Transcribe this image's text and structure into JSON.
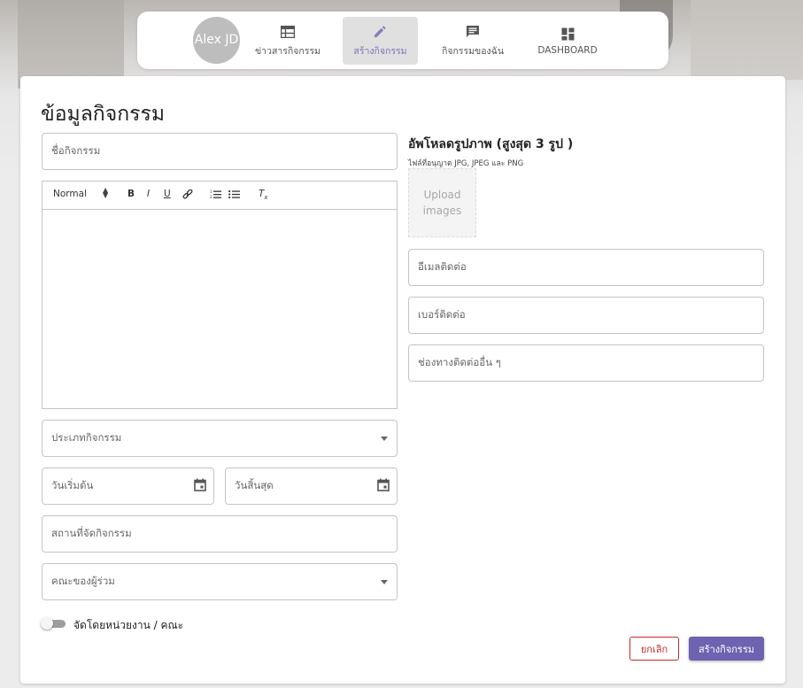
{
  "nav": {
    "avatar_text": "Alex JD",
    "items": [
      {
        "label": "ข่าวสารกิจกรรม",
        "icon": "table-icon",
        "active": false
      },
      {
        "label": "สร้างกิจกรรม",
        "icon": "pencil-icon",
        "active": true
      },
      {
        "label": "กิจกรรมของฉัน",
        "icon": "chat-icon",
        "active": false
      },
      {
        "label": "DASHBOARD",
        "icon": "dashboard-icon",
        "active": false
      }
    ]
  },
  "form": {
    "title": "ข้อมูลกิจกรรม",
    "activity_name_placeholder": "ชื่อกิจกรรม",
    "editor": {
      "format_select": "Normal",
      "tools": [
        "bold-icon",
        "italic-icon",
        "underline-icon",
        "link-icon",
        "ordered-list-icon",
        "bullet-list-icon",
        "clear-format-icon"
      ]
    },
    "activity_type_placeholder": "ประเภทกิจกรรม",
    "start_date_placeholder": "วันเริ่มต้น",
    "end_date_placeholder": "วันสิ้นสุด",
    "location_placeholder": "สถานที่จัดกิจกรรม",
    "faculty_placeholder": "คณะของผู้ร่วม",
    "toggle_label": "จัดโดยหน่วยงาน / คณะ",
    "toggle_on": false
  },
  "upload": {
    "title": "อัพโหลดรูปภาพ (สูงสุด 3 รูป )",
    "subtitle": "ไฟล์ที่อนุญาต JPG, JPEG และ PNG",
    "button_label": "Upload images"
  },
  "contact": {
    "email_placeholder": "อีเมลติดต่อ",
    "phone_placeholder": "เบอร์ติดต่อ",
    "other_placeholder": "ช่องทางติดต่ออื่น ๆ"
  },
  "actions": {
    "cancel_label": "ยกเลิก",
    "create_label": "สร้างกิจกรรม"
  },
  "colors": {
    "accent": "#6d63b1",
    "danger": "#c62828",
    "active_nav_text": "#7f6fb4"
  }
}
